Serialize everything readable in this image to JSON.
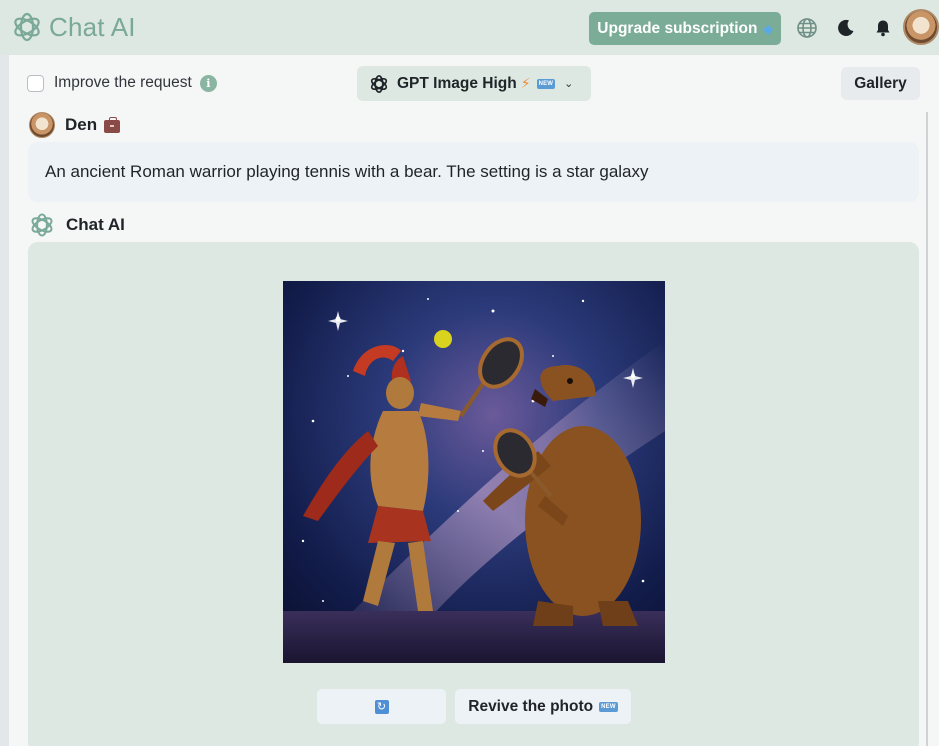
{
  "header": {
    "brand_name": "Chat AI",
    "upgrade_label": "Upgrade subscription",
    "icons": [
      "globe-icon",
      "moon-icon",
      "bell-icon"
    ]
  },
  "toolbar": {
    "improve_label": "Improve the request",
    "model_name": "GPT Image High",
    "new_badge": "NEW",
    "gallery_label": "Gallery"
  },
  "conversation": {
    "user": {
      "name": "Den",
      "message": "An ancient Roman warrior playing tennis with a bear. The setting is a star galaxy"
    },
    "assistant": {
      "name": "Chat AI",
      "revive_label": "Revive the photo",
      "new_badge": "NEW"
    }
  },
  "colors": {
    "accent": "#7aac98",
    "header_bg": "#dde8e2",
    "bubble_user": "#edf2f6",
    "bubble_ai": "#dde8e2"
  }
}
